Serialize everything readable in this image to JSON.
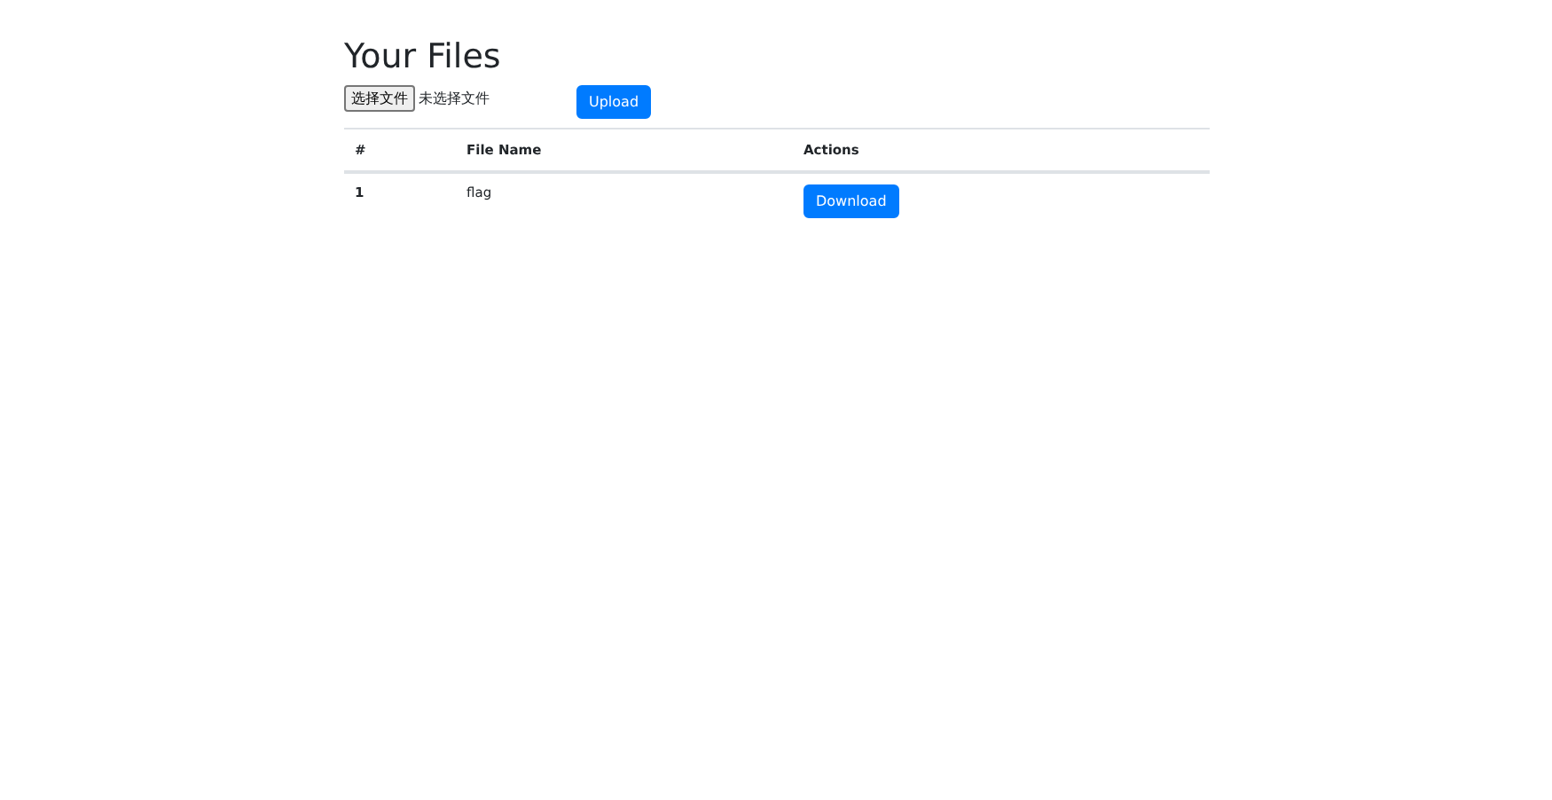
{
  "heading": "Your Files",
  "upload_form": {
    "choose_button": "选择文件",
    "file_status": "未选择文件",
    "submit_button": "Upload"
  },
  "table": {
    "columns": [
      "#",
      "File Name",
      "Actions"
    ],
    "rows": [
      {
        "index": "1",
        "file_name": "flag",
        "action": "Download"
      }
    ]
  }
}
